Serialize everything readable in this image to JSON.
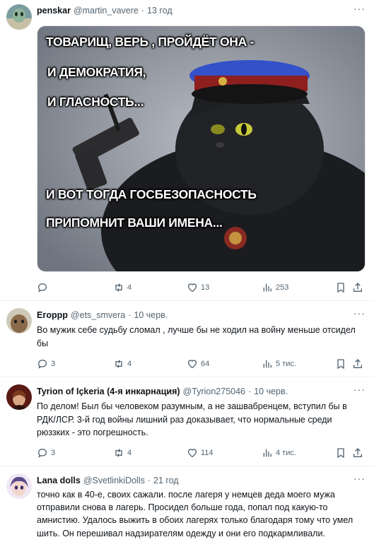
{
  "tweets": [
    {
      "name": "penskar",
      "handle": "@martin_vavere",
      "time": "13 год",
      "image_text": {
        "line1": "ТОВАРИЩ, ВЕРЬ , ПРОЙДЁТ ОНА -",
        "line2": "И ДЕМОКРАТИЯ,",
        "line3": "И ГЛАСНОСТЬ...",
        "line4": "И ВОТ ТОГДА ГОСБЕЗОПАСНОСТЬ",
        "line5": "ПРИПОМНИТ ВАШИ ИМЕНА..."
      },
      "replies": "",
      "retweets": "4",
      "likes": "13",
      "views": "253"
    },
    {
      "name": "Егорpp",
      "handle": "@ets_smvera",
      "time": "10 черв.",
      "text": "Во мужик себе судьбу сломал , лучше бы не ходил на войну меньше отсидел бы",
      "replies": "3",
      "retweets": "4",
      "likes": "64",
      "views": "5 тис."
    },
    {
      "name": "Tyrion of Içkeria (4-я инкарнация)",
      "handle": "@Tyrion275046",
      "time": "10 черв.",
      "text": "По делом! Был бы человеком разумным, а не зашвабренцем, вступил бы в РДК/ЛСР. 3-й год войны лишний раз доказывает, что нормальные среди рюззких - это погрешность.",
      "replies": "3",
      "retweets": "4",
      "likes": "114",
      "views": "4 тис."
    },
    {
      "name": "Lana dolls",
      "handle": "@SvetlinkiDolls",
      "time": "21 год",
      "text": "точно как в 40-е, своих сажали. после лагеря у немцев деда моего мужа отправили снова в лагерь. Просидел больше года, попал под какую-то амнистию. Удалось выжить в обоих лагерях только благодаря тому что умел шить. Он перешивал надзирателям одежду и они его подкармливали."
    }
  ],
  "separator": "·",
  "more": "···"
}
